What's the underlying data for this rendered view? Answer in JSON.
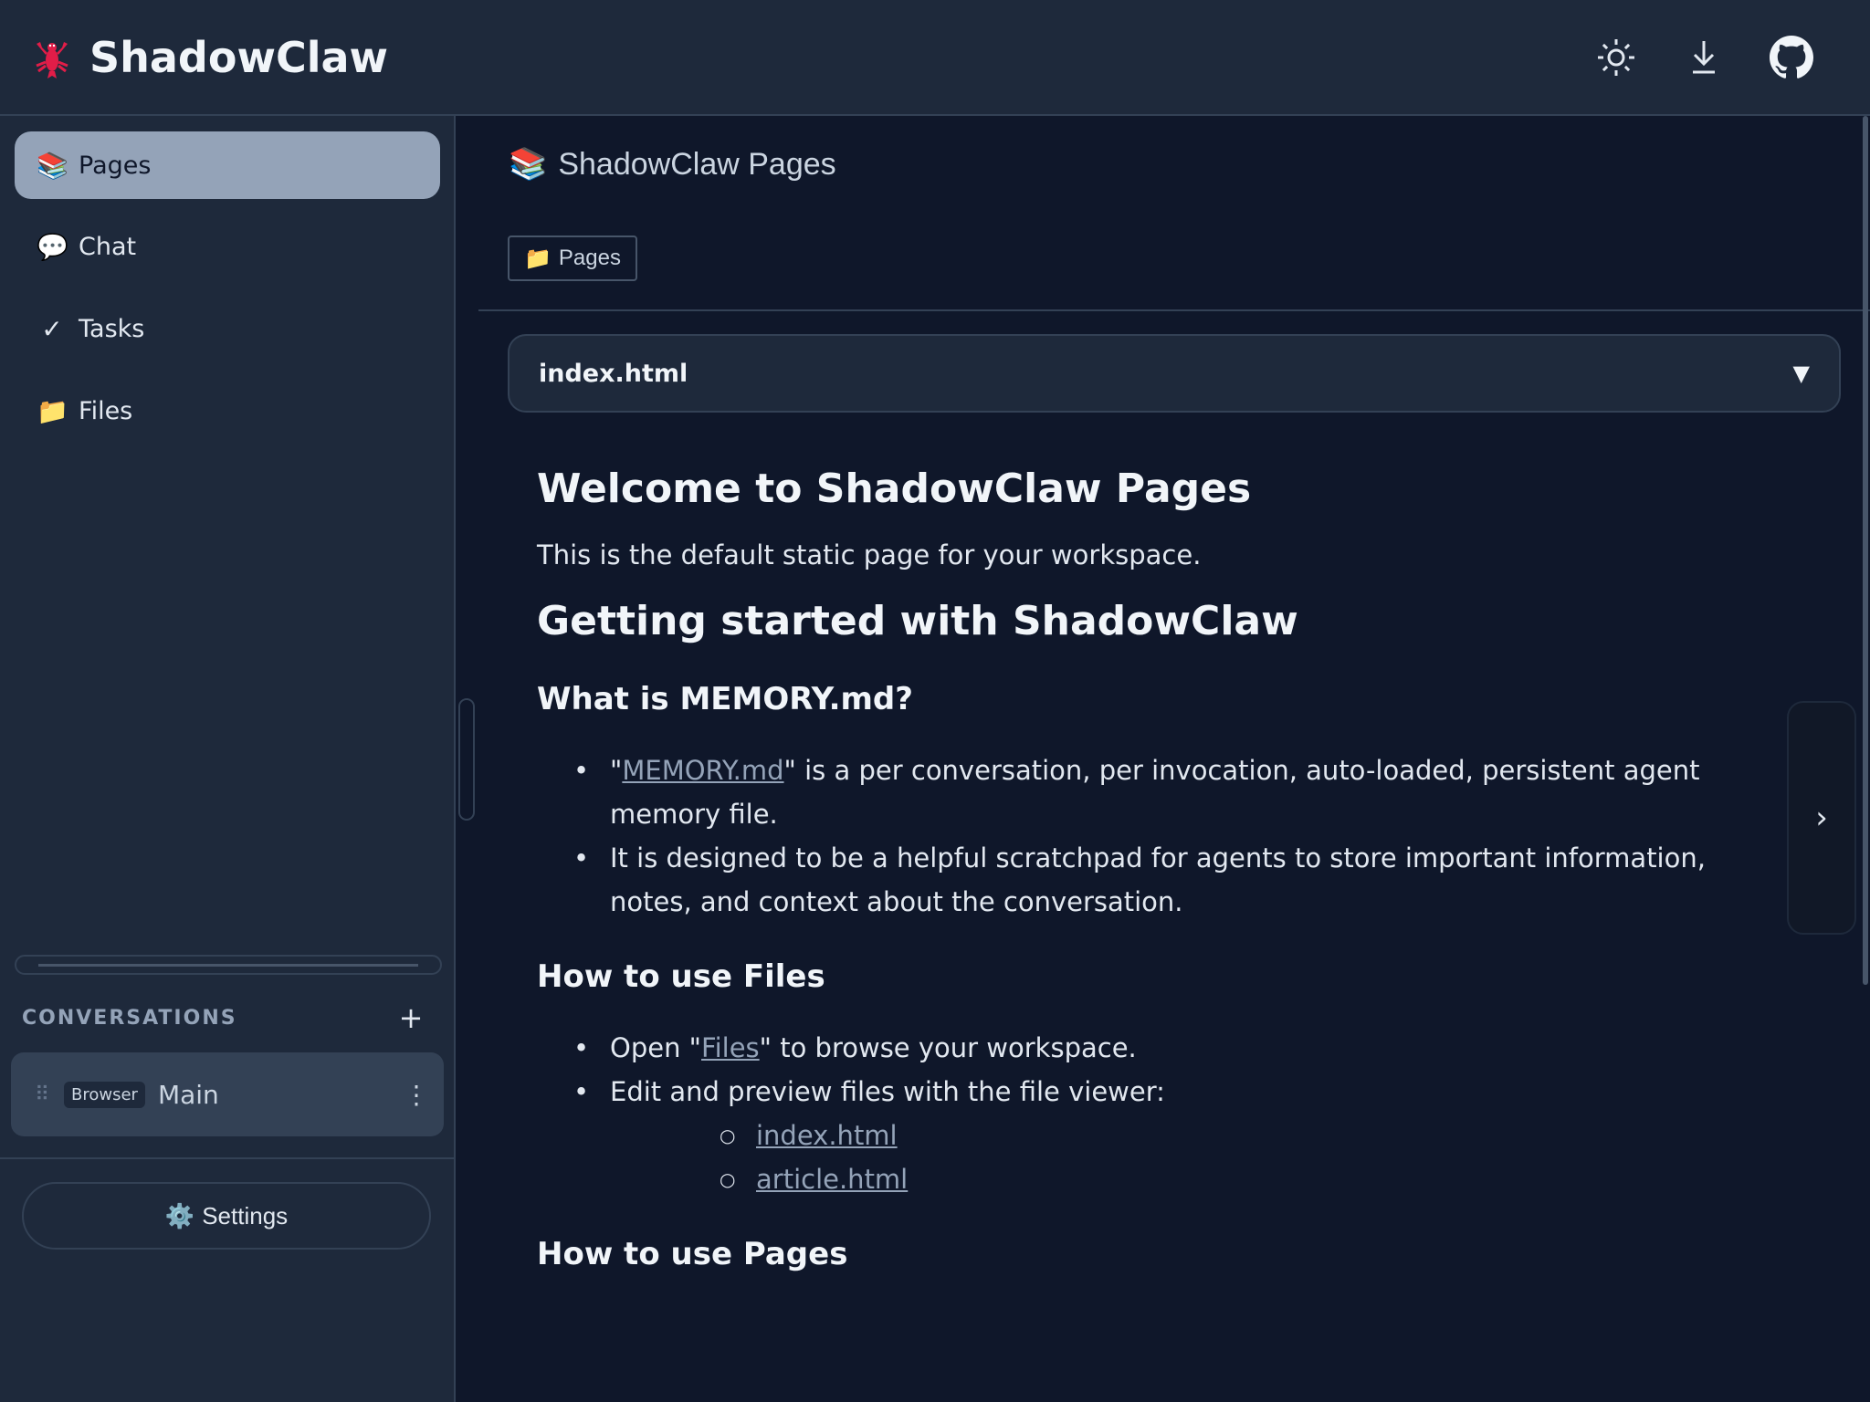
{
  "header": {
    "title": "ShadowClaw",
    "logo_icon": "lobster-icon",
    "actions": [
      {
        "icon": "sun-icon"
      },
      {
        "icon": "download-icon"
      },
      {
        "icon": "github-icon"
      }
    ]
  },
  "sidebar": {
    "items": [
      {
        "icon": "📚",
        "label": "Pages",
        "active": true
      },
      {
        "icon": "💬",
        "label": "Chat"
      },
      {
        "icon": "✓",
        "label": "Tasks"
      },
      {
        "icon": "📁",
        "label": "Files"
      }
    ],
    "conversations": {
      "title": "CONVERSATIONS",
      "add_label": "+",
      "items": [
        {
          "badge": "Browser",
          "name": "Main"
        }
      ]
    },
    "settings": {
      "icon": "⚙️",
      "label": "Settings"
    }
  },
  "main": {
    "page_title_icon": "📚",
    "page_title": "ShadowClaw Pages",
    "breadcrumb": {
      "icon": "📁",
      "label": "Pages"
    },
    "file_select": {
      "value": "index.html",
      "arrow": "▼"
    },
    "content": {
      "h1": "Welcome to ShadowClaw Pages",
      "intro": "This is the default static page for your workspace.",
      "h2": "Getting started with ShadowClaw",
      "memory_heading": "What is MEMORY.md?",
      "memory_link": "MEMORY.md",
      "memory_item1_rest": "\" is a per conversation, per invocation, auto-loaded, persistent agent memory file.",
      "memory_item2": "It is designed to be a helpful scratchpad for agents to store important information, notes, and context about the conversation.",
      "files_heading": "How to use Files",
      "files_item1_pre": "Open \"",
      "files_link": "Files",
      "files_item1_post": "\" to browse your workspace.",
      "files_item2": "Edit and preview files with the file viewer:",
      "sub_links": [
        "index.html",
        "article.html"
      ],
      "pages_heading": "How to use Pages"
    },
    "side_tab_icon": "›"
  }
}
